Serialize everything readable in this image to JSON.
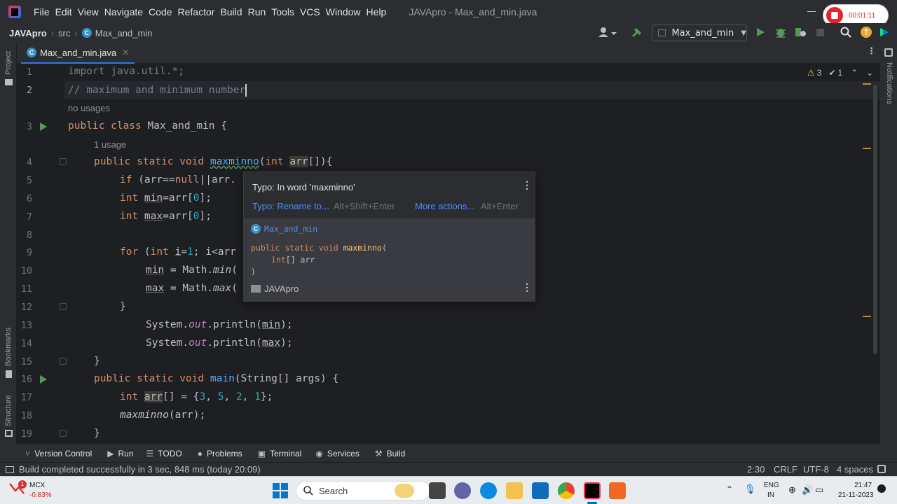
{
  "menu": [
    "File",
    "Edit",
    "View",
    "Navigate",
    "Code",
    "Refactor",
    "Build",
    "Run",
    "Tools",
    "VCS",
    "Window",
    "Help"
  ],
  "window_title": "JAVApro - Max_and_min.java",
  "recorder": {
    "time": "00:01:11"
  },
  "nav": {
    "project": "JAVApro",
    "src": "src",
    "file": "Max_and_min",
    "run_config": "Max_and_min"
  },
  "tab": {
    "label": "Max_and_min.java"
  },
  "side": {
    "project": "Project",
    "bookmarks": "Bookmarks",
    "structure": "Structure",
    "notifications": "Notifications"
  },
  "inspections": {
    "warnings": "3",
    "weak": "1"
  },
  "gutter": {
    "lines": [
      "1",
      "2",
      "3",
      "4",
      "5",
      "6",
      "7",
      "8",
      "9",
      "10",
      "11",
      "12",
      "13",
      "14",
      "15",
      "16",
      "17",
      "18",
      "19"
    ]
  },
  "hints": {
    "no_usages": "no usages",
    "one_usage": "1 usage"
  },
  "code": {
    "l1": "import java.util.*;",
    "l2": "// maximum and minimum number",
    "l3_kw": "public class ",
    "l3_name": "Max_and_min",
    "l3_rest": " {",
    "l4_kw": "public static void ",
    "l4_fn": "maxminno",
    "l4_a": "(",
    "l4_int": "int ",
    "l4_arr": "arr",
    "l4_rest": "[]){",
    "l5_if": "if ",
    "l5_a": "(arr==",
    "l5_null": "null",
    "l5_b": "||arr.",
    "l6_int": "int ",
    "l6_var": "min",
    "l6_a": "=arr[",
    "l6_num": "0",
    "l6_b": "];",
    "l7_int": "int ",
    "l7_var": "max",
    "l7_a": "=arr[",
    "l7_num": "0",
    "l7_b": "];",
    "l9_for": "for ",
    "l9_a": "(",
    "l9_int": "int ",
    "l9_i": "i",
    "l9_b": "=",
    "l9_num": "1",
    "l9_c": "; i<arr",
    "l10_var": "min",
    "l10_a": " = Math.",
    "l10_fn": "min",
    "l10_b": "(",
    "l11_var": "max",
    "l11_a": " = Math.",
    "l11_fn": "max",
    "l11_b": "(",
    "l12": "}",
    "l13_a": "System.",
    "l13_out": "out",
    "l13_b": ".println(",
    "l13_var": "min",
    "l13_c": ");",
    "l14_a": "System.",
    "l14_out": "out",
    "l14_b": ".println(",
    "l14_var": "max",
    "l14_c": ");",
    "l15": "}",
    "l16_kw": "public static void ",
    "l16_fn": "main",
    "l16_rest": "(String[] args) {",
    "l17_int": "int ",
    "l17_arr": "arr",
    "l17_a": "[] = {",
    "l17_n1": "3",
    "l17_c1": ", ",
    "l17_n2": "5",
    "l17_c2": ", ",
    "l17_n3": "2",
    "l17_c3": ", ",
    "l17_n4": "1",
    "l17_b": "};",
    "l18_fn": "maxminno",
    "l18_rest": "(arr);",
    "l19": "}"
  },
  "popup": {
    "title": "Typo: In word 'maxminno'",
    "action1": "Typo: Rename to...",
    "action1_shortcut": "Alt+Shift+Enter",
    "action2": "More actions...",
    "action2_shortcut": "Alt+Enter",
    "class_name": "Max_and_min",
    "sig_kw": "public static void ",
    "sig_fn": "maxminno",
    "sig_open": "(",
    "sig_param_kw": "int",
    "sig_param": "[] arr",
    "sig_close": ")",
    "project": "JAVApro"
  },
  "toolwindows": [
    "Version Control",
    "Run",
    "TODO",
    "Problems",
    "Terminal",
    "Services",
    "Build"
  ],
  "status": {
    "message": "Build completed successfully in 3 sec, 848 ms (today 20:09)",
    "position": "2:30",
    "line_sep": "CRLF",
    "encoding": "UTF-8",
    "indent": "4 spaces"
  },
  "taskbar": {
    "stock_name": "MCX",
    "stock_change": "-0.83%",
    "stock_badge": "1",
    "search": "Search",
    "lang1": "ENG",
    "lang2": "IN",
    "time": "21:47",
    "date": "21-11-2023"
  },
  "colors": {
    "accent": "#3574f0",
    "keyword": "#cf8e6d",
    "function": "#56a8f5",
    "number": "#2aacb8",
    "run": "#57965c"
  }
}
